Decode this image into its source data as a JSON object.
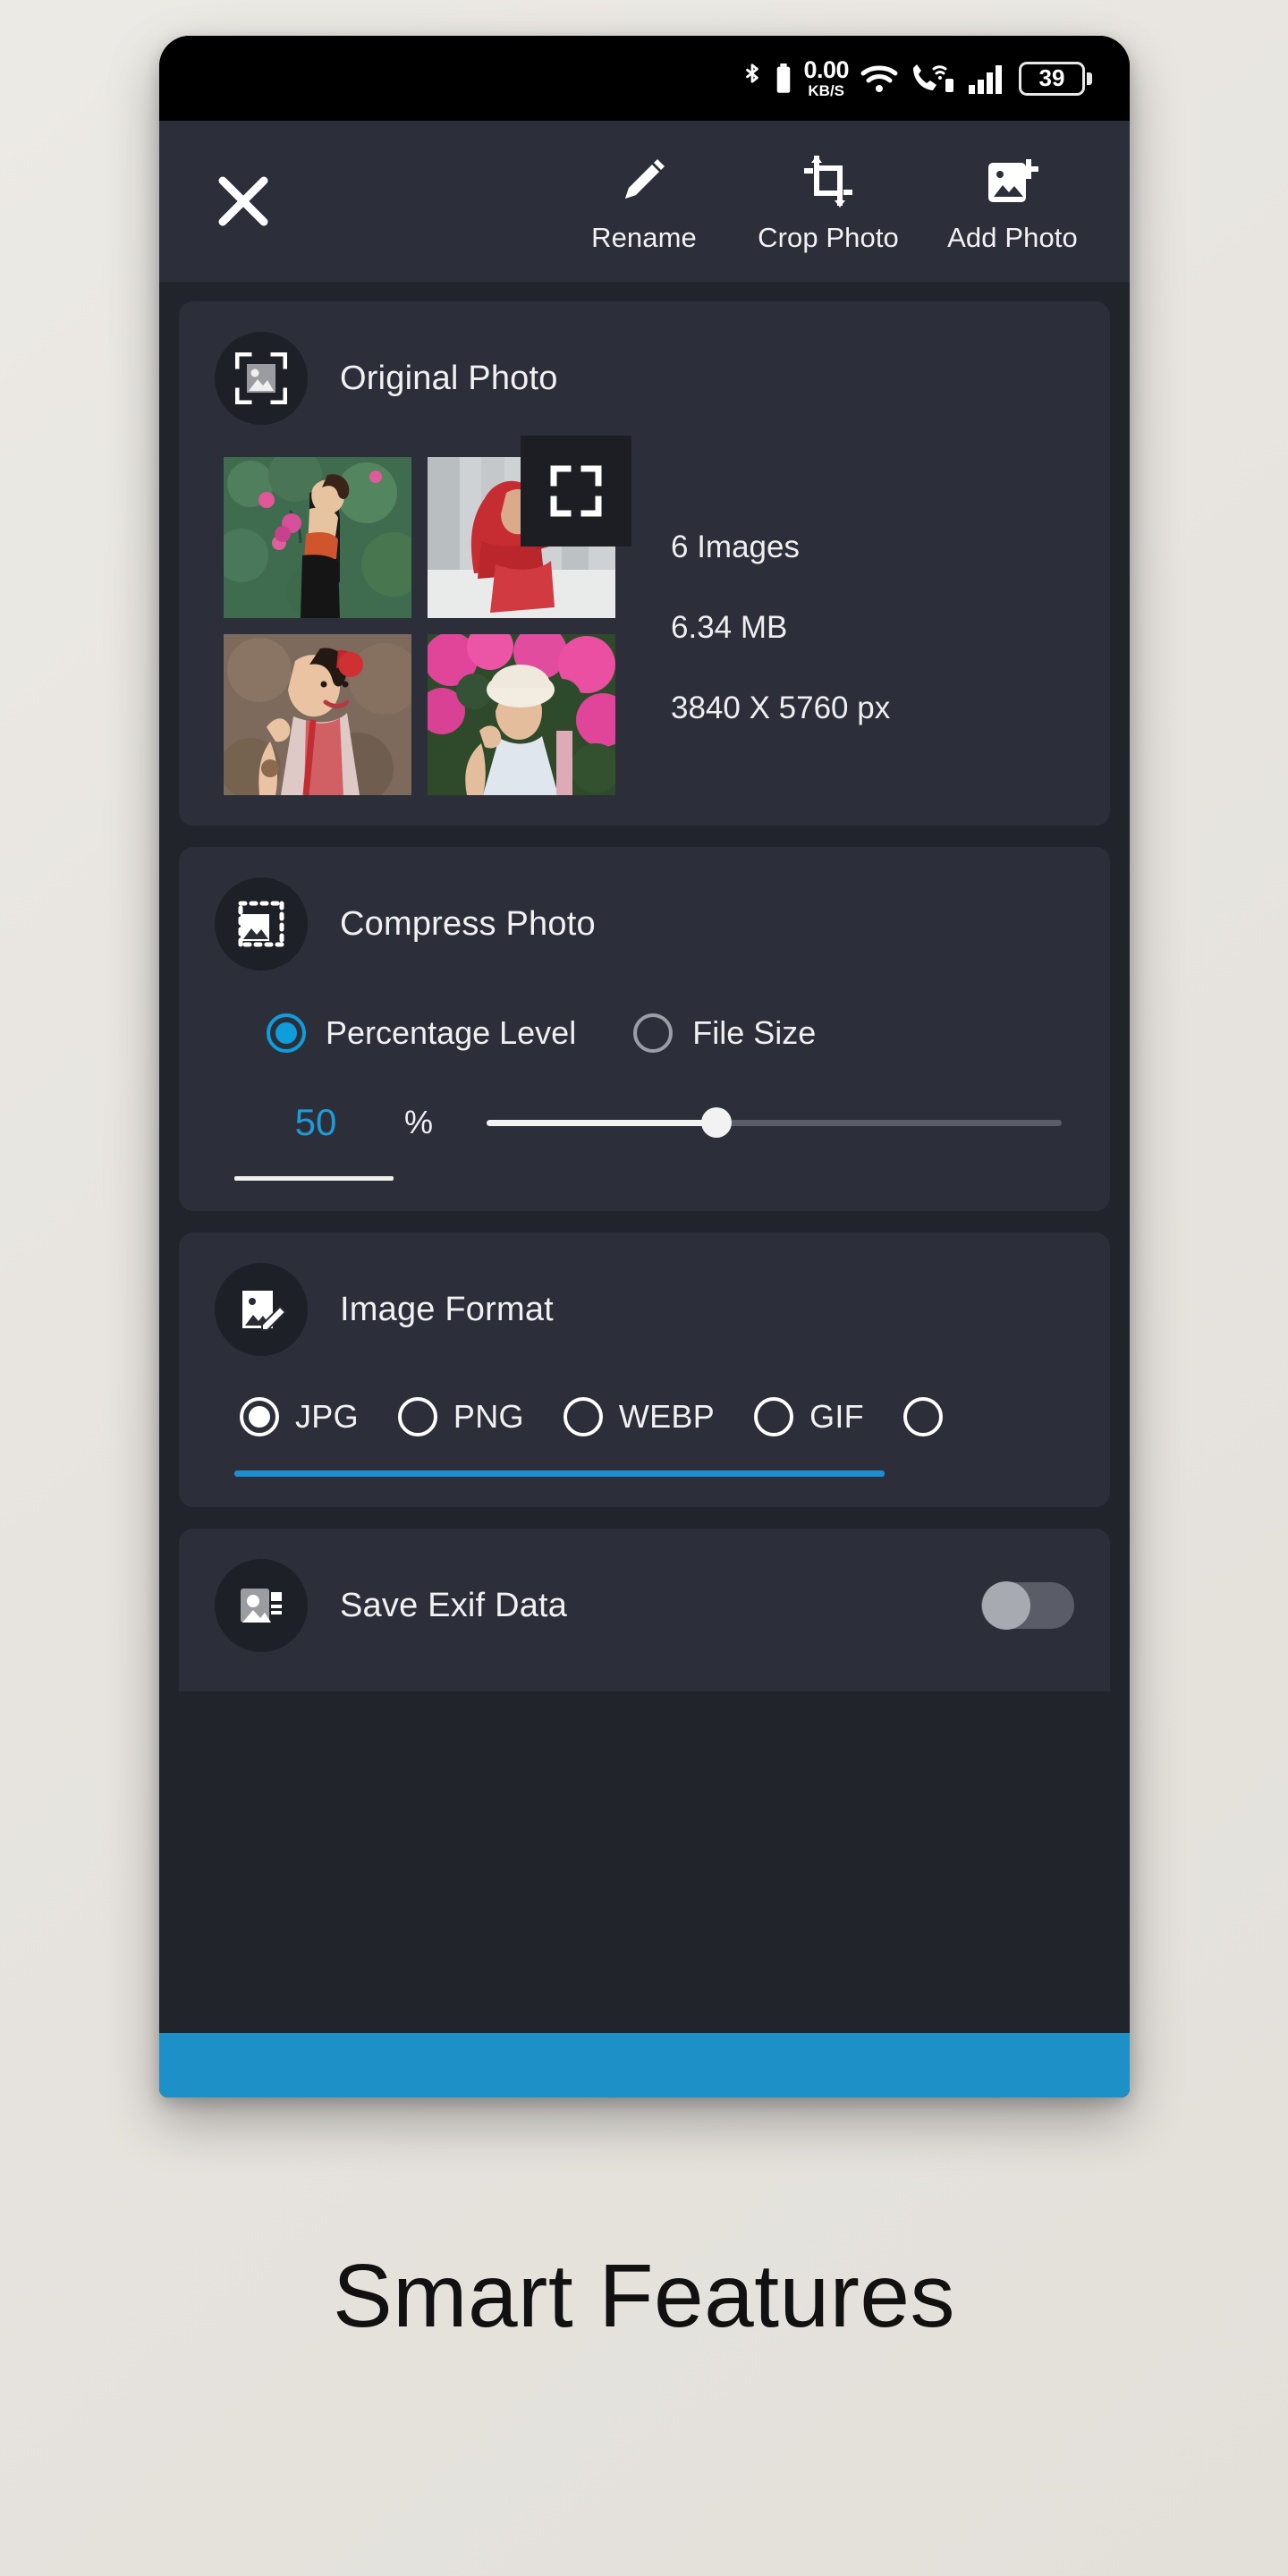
{
  "statusbar": {
    "icons": [
      "bluetooth-icon",
      "battery-small-icon",
      "wifi-icon",
      "vowifi-call-icon",
      "signal-bars-icon"
    ],
    "network_speed_value": "0.00",
    "network_speed_unit": "KB/S",
    "battery_percent": "39"
  },
  "toolbar": {
    "close_label": "close-icon",
    "actions": [
      {
        "label": "Rename",
        "icon": "pencil-icon"
      },
      {
        "label": "Crop Photo",
        "icon": "crop-icon"
      },
      {
        "label": "Add Photo",
        "icon": "add-photo-icon"
      }
    ]
  },
  "original_photo": {
    "title": "Original Photo",
    "icon": "framed-image-icon",
    "expand_icon": "expand-fullscreen-icon",
    "stats": {
      "count": "6 Images",
      "size": "6.34 MB",
      "dimensions": "3840 X 5760 px"
    },
    "thumbnails": [
      {
        "name": "woman-in-lotus-pond"
      },
      {
        "name": "woman-in-red-veil"
      },
      {
        "name": "woman-smiling-red-ao-dai"
      },
      {
        "name": "woman-with-hat-pink-flowers"
      }
    ]
  },
  "compress": {
    "title": "Compress Photo",
    "icon": "compress-image-icon",
    "modes": [
      {
        "label": "Percentage Level",
        "selected": true
      },
      {
        "label": "File Size",
        "selected": false
      }
    ],
    "value": "50",
    "unit": "%",
    "slider_position_percent": 40
  },
  "image_format": {
    "title": "Image Format",
    "icon": "edit-image-icon",
    "options": [
      {
        "label": "JPG",
        "selected": true
      },
      {
        "label": "PNG",
        "selected": false
      },
      {
        "label": "WEBP",
        "selected": false
      },
      {
        "label": "GIF",
        "selected": false
      },
      {
        "label": "",
        "selected": false
      }
    ]
  },
  "exif": {
    "title": "Save Exif Data",
    "icon": "exif-contact-image-icon",
    "enabled": false
  },
  "caption": "Smart Features",
  "colors": {
    "accent_blue": "#1d9bd8",
    "underline_blue": "#1d8fd1",
    "bottom_bar_blue": "#1e90c8",
    "card_bg": "#2c2f39",
    "page_bg": "#22242c",
    "frame_bg": "#e8e5e0"
  }
}
